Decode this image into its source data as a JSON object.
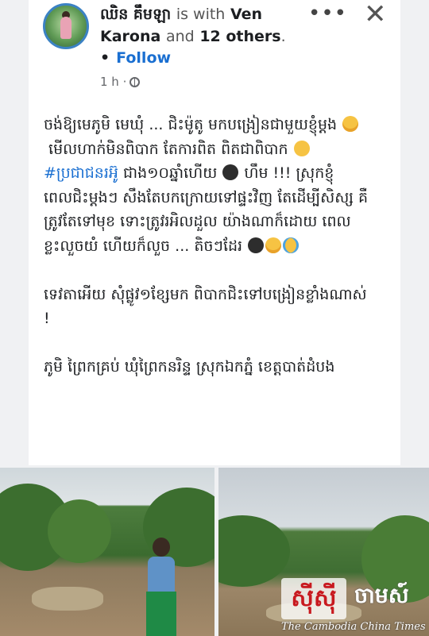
{
  "post": {
    "author": "ឈិន គឹមឡា",
    "with_text": "is with",
    "tagged": "Ven Karona",
    "and_text": "and",
    "others": "12 others",
    "period": ".",
    "follow_label": "Follow",
    "time": "1 h",
    "body": {
      "line1": "ចង់ឱ្យមេភូមិ មេឃុំ ... ជិះម៉ូតូ មកបង្រៀនជាមួយខ្ញុំម្តង ",
      "line2": " មើលហាក់មិនពិបាក តែការពិត ពិតជាពិបាក ",
      "hashtag": "#ប្រជាជនរអ៊ូ",
      "line3": " ជាង១០ឆ្នាំហើយ ",
      "line4": " ហឹម !!! ស្រុកខ្ញុំពេលជិះម្តងៗ សឹងតែបកក្រោយទៅផ្ទះវិញ តែដើម្បីសិស្ស គឺត្រូវតែទៅមុខ ទោះត្រូវរអិលដួល យ៉ាងណាក៏ដោយ ពេលខ្លះលួចយំ ហើយក៏លួច ... តិចៗដែរ ",
      "para2": "ទេវតាអើយ សុំផ្លូវ១ខ្សែមក ពិបាកជិះទៅបង្រៀនខ្លាំងណាស់ !",
      "para3": "ភូមិ ព្រៃកគ្រប់ ឃុំព្រៃកនរិន្ទ ស្រុកឯកភ្នំ ខេត្តបាត់ដំបង"
    }
  },
  "watermark": {
    "logo": "សុីស៊ី",
    "label": "ចាមស៍",
    "sub": "The Cambodia China Times"
  },
  "icons": [
    "more-icon",
    "close-icon",
    "globe-icon",
    "steam-face-icon",
    "frown-face-icon",
    "black-face-icon",
    "crying-face-icon"
  ],
  "colors": {
    "link": "#1a6fd1",
    "text": "#1c1e21",
    "meta": "#65676b"
  }
}
